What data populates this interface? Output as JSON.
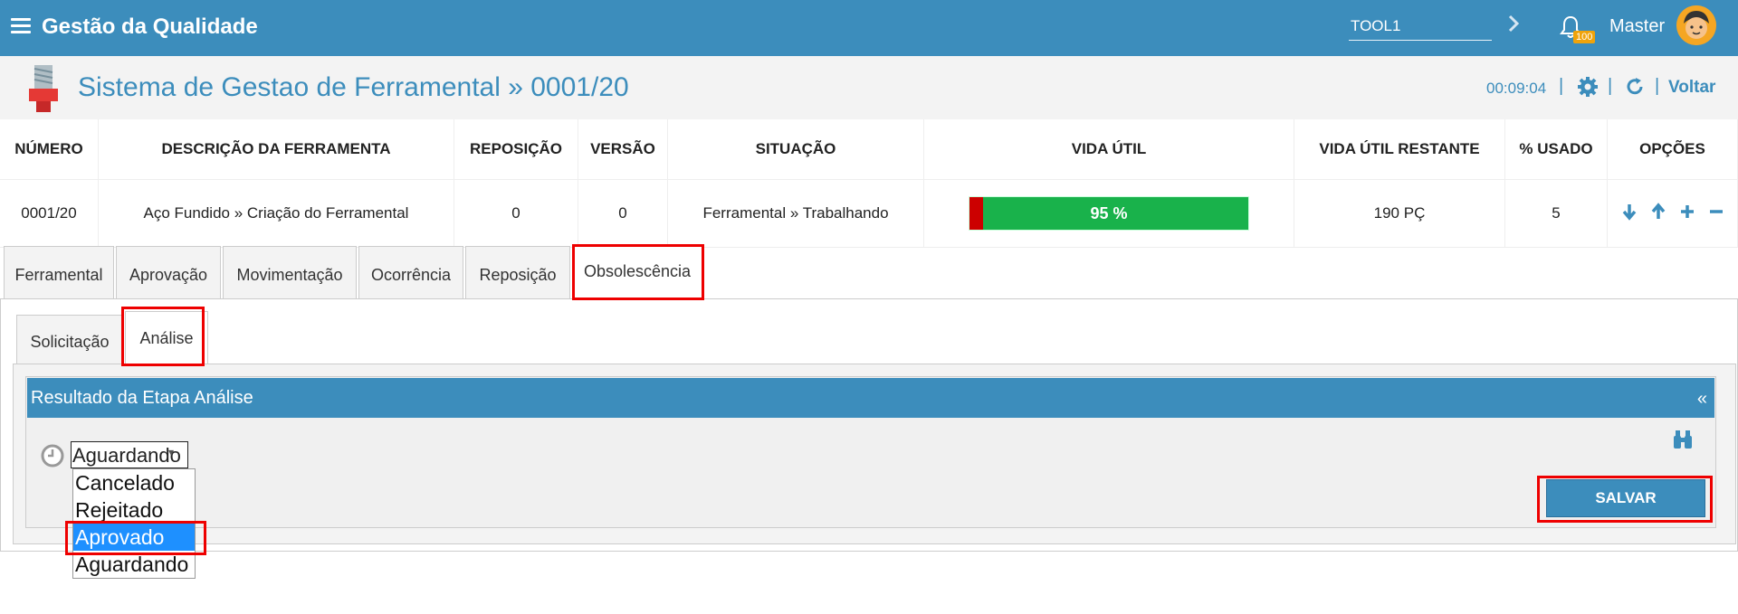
{
  "app": {
    "title": "Gestão da Qualidade"
  },
  "topbar": {
    "search_value": "TOOL1",
    "notifications": "100",
    "user": "Master"
  },
  "header": {
    "title": "Sistema de Gestao de Ferramental » 0001/20",
    "timer": "00:09:04",
    "back_label": "Voltar"
  },
  "table": {
    "headers": [
      "NÚMERO",
      "DESCRIÇÃO DA FERRAMENTA",
      "REPOSIÇÃO",
      "VERSÃO",
      "SITUAÇÃO",
      "VIDA ÚTIL",
      "VIDA ÚTIL RESTANTE",
      "% USADO",
      "OPÇÕES"
    ],
    "row": {
      "numero": "0001/20",
      "descricao": "Aço Fundido » Criação do Ferramental",
      "reposicao": "0",
      "versao": "0",
      "situacao": "Ferramental » Trabalhando",
      "vida_util_label": "95 %",
      "vida_util_restante": "190 PÇ",
      "usado": "5"
    }
  },
  "life_bar": {
    "remaining_percent": 95,
    "used_color": "#cc0000",
    "remaining_color": "#19b24b"
  },
  "tabs": [
    "Ferramental",
    "Aprovação",
    "Movimentação",
    "Ocorrência",
    "Reposição",
    "Obsolescência"
  ],
  "subtabs": [
    "Solicitação",
    "Análise"
  ],
  "result": {
    "title": "Resultado da Etapa Análise",
    "collapse": "«",
    "selected": "Aguardando",
    "options": [
      "Cancelado",
      "Rejeitado",
      "Aprovado",
      "Aguardando"
    ],
    "save_label": "SALVAR"
  },
  "colors": {
    "primary": "#3c8dbc",
    "highlight": "#e00000",
    "selection": "#1e90ff",
    "badge": "#f0a30a"
  }
}
